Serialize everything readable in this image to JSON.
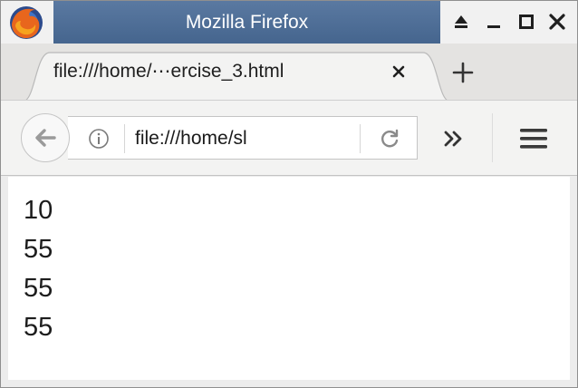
{
  "window": {
    "title": "Mozilla Firefox",
    "app_icon": "firefox-logo-icon",
    "controls": [
      {
        "name": "eject-icon"
      },
      {
        "name": "minimize-icon"
      },
      {
        "name": "maximize-icon"
      },
      {
        "name": "close-icon"
      }
    ]
  },
  "tabs": [
    {
      "label": "file:///home/⋯ercise_3.html",
      "active": true
    }
  ],
  "toolbar": {
    "url": "file:///home/sl",
    "icons": [
      "back-arrow-icon",
      "info-icon",
      "reload-icon",
      "overflow-chevron-icon",
      "hamburger-menu-icon",
      "new-tab-plus-icon",
      "tab-close-icon"
    ]
  },
  "page": {
    "lines": [
      "10",
      "55",
      "55",
      "55"
    ]
  },
  "colors": {
    "titlebar": "#4f6f98",
    "title_text": "#ffffff",
    "icon_gray": "#555555",
    "page_bg": "#ffffff",
    "chrome_bg": "#e4e3e1"
  }
}
